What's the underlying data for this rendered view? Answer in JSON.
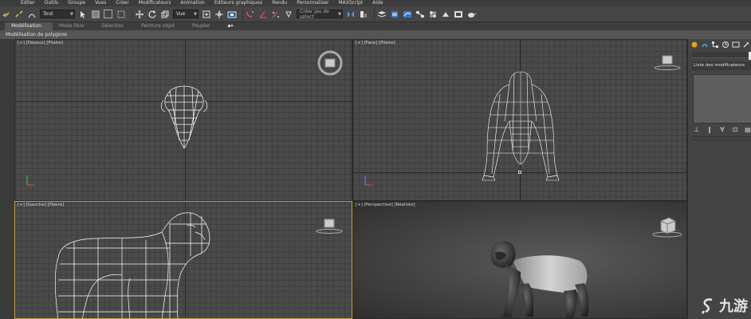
{
  "menubar": {
    "items": [
      "Editer",
      "Outils",
      "Groupe",
      "Vues",
      "Créer",
      "Modificateurs",
      "Animation",
      "Editeurs graphiques",
      "Rendu",
      "Personnaliser",
      "MAXScript",
      "Aide"
    ]
  },
  "toolbar": {
    "filter_select": "Tout",
    "view_select": "Vue",
    "selection_set_placeholder": "Créer jeu de sélect"
  },
  "ribbon": {
    "tabs": [
      "Modélisation",
      "Mode libre",
      "Sélection",
      "Peinture objet",
      "Peupler"
    ],
    "active_tab": "Modélisation",
    "sub_label": "Modélisation de polygone"
  },
  "viewports": {
    "top": {
      "label": "[+] [Dessus] [Filaire]"
    },
    "front": {
      "label": "[+] [Face] [Filaire]"
    },
    "left": {
      "label": "[+] [Gauche] [Filaire]"
    },
    "perspective": {
      "label": "[+] [Perspective] [Réaliste]"
    }
  },
  "command_panel": {
    "modifier_list_label": "Liste des modificateurs"
  },
  "watermark": {
    "text": "九游"
  },
  "colors": {
    "active_viewport_border": "#c8a23a",
    "grid_line": "#3f3f3f",
    "wireframe": "#ffffff"
  }
}
